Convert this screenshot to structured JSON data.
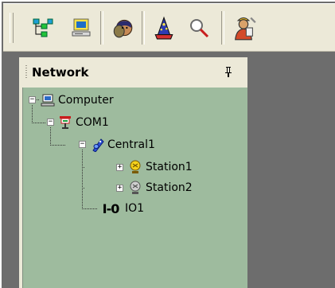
{
  "toolbar": {
    "buttons": [
      {
        "name": "tree-view-icon"
      },
      {
        "name": "computer-icon"
      },
      {
        "name": "user-face-icon"
      },
      {
        "name": "wizard-icon"
      },
      {
        "name": "magnifier-icon"
      },
      {
        "name": "worker-icon"
      }
    ]
  },
  "panel": {
    "title": "Network",
    "pin_glyph": "ᵽ"
  },
  "tree": {
    "computer": {
      "label": "Computer",
      "expander": "−"
    },
    "com1": {
      "label": "COM1",
      "expander": "−"
    },
    "central1": {
      "label": "Central1",
      "expander": "−"
    },
    "station1": {
      "label": "Station1",
      "expander": "+"
    },
    "station2": {
      "label": "Station2",
      "expander": "+"
    },
    "io1": {
      "label": "IO1",
      "icon_text": "I-0"
    }
  },
  "colors": {
    "toolbar_bg": "#ece9d8",
    "tree_bg": "#9ebb9e",
    "workspace_bg": "#6d6d6d"
  }
}
